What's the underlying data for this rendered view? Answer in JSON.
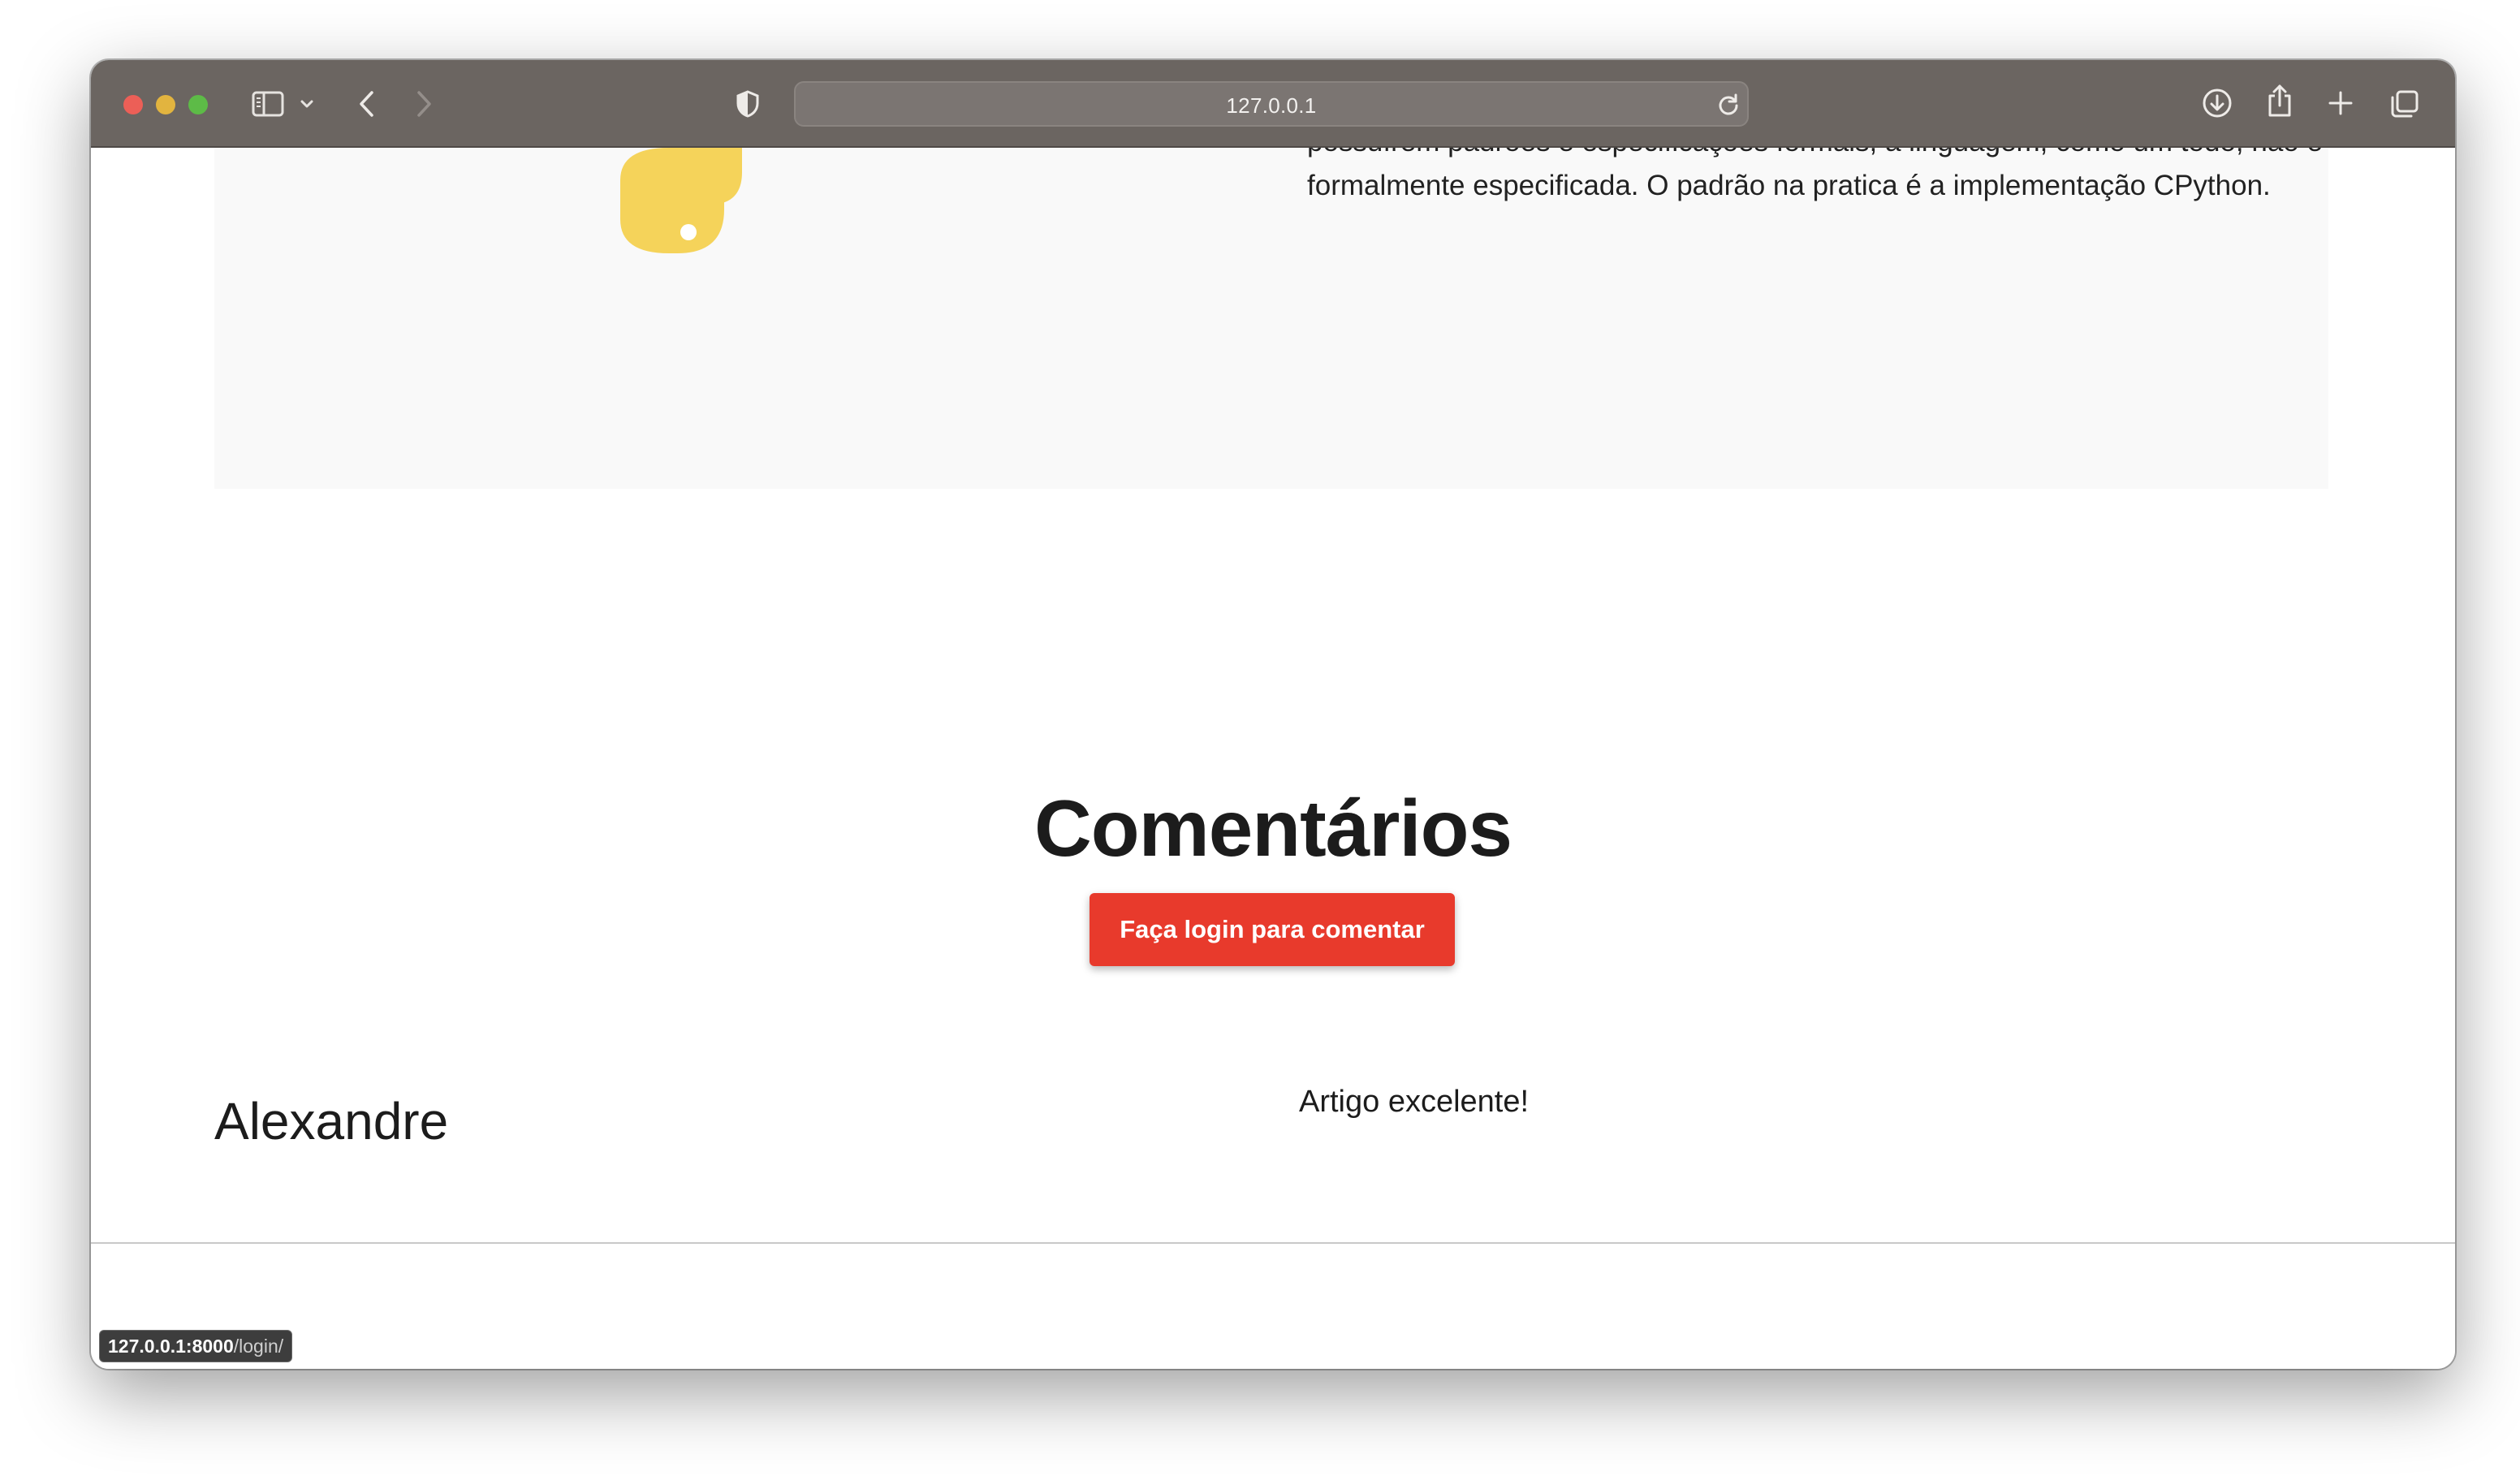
{
  "browser": {
    "url_display": "127.0.0.1",
    "status_url_host": "127.0.0.1:8000",
    "status_url_path": "/login/"
  },
  "article": {
    "text_lines": [
      "possuírem padrões e especificações formais, a linguagem, como um todo, não é",
      "formalmente especificada. O padrão na pratica é a implementação CPython."
    ]
  },
  "comments": {
    "title": "Comentários",
    "login_button_label": "Faça login para comentar",
    "items": [
      {
        "author": "Alexandre",
        "text": "Artigo excelente!"
      }
    ]
  },
  "colors": {
    "accent_button": "#e83a2c",
    "toolbar": "#6b6561"
  },
  "icons": [
    "sidebar-icon",
    "chevron-down-icon",
    "back-icon",
    "forward-icon",
    "shield-icon",
    "reload-icon",
    "download-icon",
    "share-icon",
    "new-tab-icon",
    "tab-overview-icon",
    "python-logo"
  ]
}
